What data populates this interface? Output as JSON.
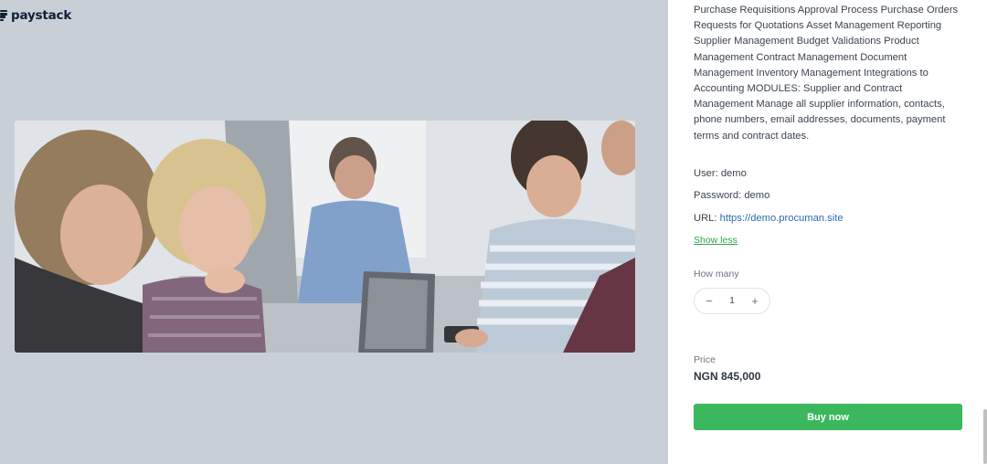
{
  "brand": {
    "name": "paystack"
  },
  "hero": {
    "alt": ""
  },
  "product": {
    "description": "Purchase Requisitions Approval Process Purchase Orders Requests for Quotations Asset Management Reporting Supplier Management Budget Validations Product Management Contract Management Document Management Inventory Management Integrations to Accounting MODULES: Supplier and Contract Management Manage all supplier information, contacts, phone numbers, email addresses, documents, payment terms and contract dates.",
    "user_line": "User: demo",
    "password_line": "Password: demo",
    "url_prefix": "URL: ",
    "url_text": "https://demo.procuman.site",
    "show_less": "Show less"
  },
  "quantity": {
    "label": "How many",
    "value": "1",
    "minus": "−",
    "plus": "+"
  },
  "price": {
    "label": "Price",
    "value": "NGN 845,000"
  },
  "buy_button": {
    "label": "Buy now"
  },
  "colors": {
    "accent": "#3bb75e",
    "link": "#2b6cb0",
    "brand": "#0d2137"
  }
}
